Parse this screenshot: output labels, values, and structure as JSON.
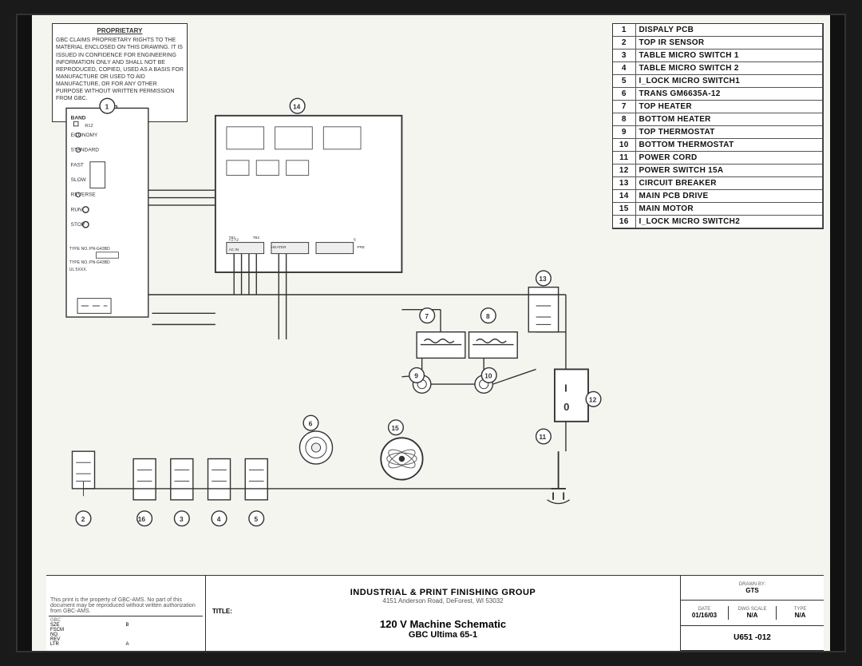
{
  "proprietary": {
    "title": "PROPRIETARY",
    "text": "GBC CLAIMS PROPRIETARY RIGHTS TO THE MATERIAL ENCLOSED ON THIS DRAWING. IT IS ISSUED IN CONFIDENCE FOR ENGINEERING INFORMATION ONLY AND SHALL NOT BE REPRODUCED, COPIED, USED AS A BASIS FOR MANUFACTURE OR USED TO AID MANUFACTURE, OR FOR ANY OTHER PURPOSE WITHOUT WRITTEN PERMISSION FROM GBC."
  },
  "parts_list": [
    {
      "num": "1",
      "label": "DISPALY PCB"
    },
    {
      "num": "2",
      "label": "TOP IR SENSOR"
    },
    {
      "num": "3",
      "label": "TABLE MICRO SWITCH 1"
    },
    {
      "num": "4",
      "label": "TABLE MICRO SWITCH 2"
    },
    {
      "num": "5",
      "label": "I_LOCK MICRO SWITCH1"
    },
    {
      "num": "6",
      "label": "TRANS GM6635A-12"
    },
    {
      "num": "7",
      "label": "TOP HEATER"
    },
    {
      "num": "8",
      "label": "BOTTOM HEATER"
    },
    {
      "num": "9",
      "label": "TOP THERMOSTAT"
    },
    {
      "num": "10",
      "label": "BOTTOM THERMOSTAT"
    },
    {
      "num": "11",
      "label": "POWER CORD"
    },
    {
      "num": "12",
      "label": "POWER SWITCH 15A"
    },
    {
      "num": "13",
      "label": "CIRCUIT BREAKER"
    },
    {
      "num": "14",
      "label": "MAIN PCB DRIVE"
    },
    {
      "num": "15",
      "label": "MAIN MOTOR"
    },
    {
      "num": "16",
      "label": "I_LOCK MICRO SWITCH2"
    }
  ],
  "title_block": {
    "company": "INDUSTRIAL & PRINT FINISHING GROUP",
    "address": "4151 Anderson Road, DeForest, WI 53032",
    "title_label": "TITLE:",
    "title": "120 V Machine Schematic",
    "subtitle": "GBC Ultima 65-1",
    "drawn_by": "GTS",
    "date": "01/16/03",
    "dwg_scale": "N/A",
    "type": "N/A",
    "dwg_num": "U651 -012",
    "size": "B",
    "columns": [
      "DATE",
      "DWG SCALE",
      "TYPE"
    ],
    "col_values": [
      "01/16/03",
      "N/A",
      "N/A"
    ],
    "drawn_label": "DRAWN BY:",
    "drawn_row": "GTS"
  },
  "component_numbers": [
    "1",
    "2",
    "3",
    "4",
    "5",
    "6",
    "7",
    "8",
    "9",
    "10",
    "11",
    "12",
    "13",
    "14",
    "15",
    "16"
  ],
  "copyright": "This print is the property of GBC-AMS. No part of this document may be reproduced without written authorization from GBC-AMS."
}
